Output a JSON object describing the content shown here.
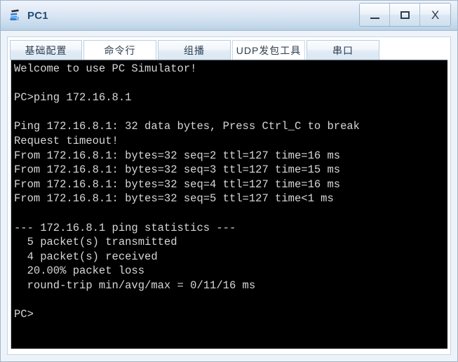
{
  "window": {
    "title": "PC1",
    "icon": "pc-device-icon",
    "controls": {
      "minimize_label": "–",
      "maximize_label": "□",
      "close_label": "X"
    },
    "colors": {
      "titlebar_top": "#eef3fb",
      "titlebar_bottom": "#bcd3e8",
      "title_text": "#1f4e79",
      "border": "#9fb6cc",
      "terminal_bg": "#000000",
      "terminal_fg": "#d7d7d7"
    }
  },
  "tabs": [
    {
      "label": "基础配置",
      "selected": false
    },
    {
      "label": "命令行",
      "selected": true
    },
    {
      "label": "组播",
      "selected": false
    },
    {
      "label": "UDP发包工具",
      "selected": false
    },
    {
      "label": "串口",
      "selected": false
    }
  ],
  "terminal": {
    "lines": [
      "Welcome to use PC Simulator!",
      "",
      "PC>ping 172.16.8.1",
      "",
      "Ping 172.16.8.1: 32 data bytes, Press Ctrl_C to break",
      "Request timeout!",
      "From 172.16.8.1: bytes=32 seq=2 ttl=127 time=16 ms",
      "From 172.16.8.1: bytes=32 seq=3 ttl=127 time=15 ms",
      "From 172.16.8.1: bytes=32 seq=4 ttl=127 time=16 ms",
      "From 172.16.8.1: bytes=32 seq=5 ttl=127 time<1 ms",
      "",
      "--- 172.16.8.1 ping statistics ---",
      "  5 packet(s) transmitted",
      "  4 packet(s) received",
      "  20.00% packet loss",
      "  round-trip min/avg/max = 0/11/16 ms",
      "",
      "PC>"
    ]
  }
}
